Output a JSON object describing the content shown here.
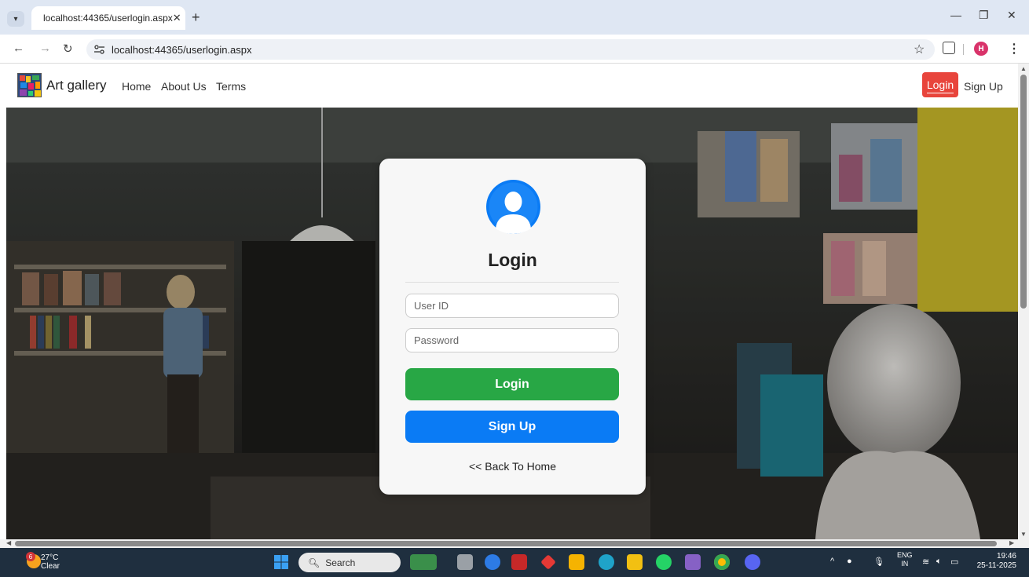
{
  "browser": {
    "tab_title": "localhost:44365/userlogin.aspx",
    "url": "localhost:44365/userlogin.aspx",
    "profile_initial": "H"
  },
  "site": {
    "brand": "Art gallery",
    "nav": [
      {
        "label": "Home"
      },
      {
        "label": "About Us"
      },
      {
        "label": "Terms"
      }
    ],
    "login_label": "Login",
    "signup_label": "Sign Up"
  },
  "login_card": {
    "title": "Login",
    "userid_placeholder": "User ID",
    "password_placeholder": "Password",
    "login_button": "Login",
    "signup_button": "Sign Up",
    "back_link": "<< Back To Home"
  },
  "taskbar": {
    "weather_badge": "6",
    "temperature": "27°C",
    "condition": "Clear",
    "search_label": "Search",
    "lang_top": "ENG",
    "lang_bottom": "IN",
    "time": "19:46",
    "date": "25-11-2025"
  },
  "colors": {
    "login_green": "#28a745",
    "signup_blue": "#0a7bf5",
    "nav_login_red": "#e8453c"
  }
}
